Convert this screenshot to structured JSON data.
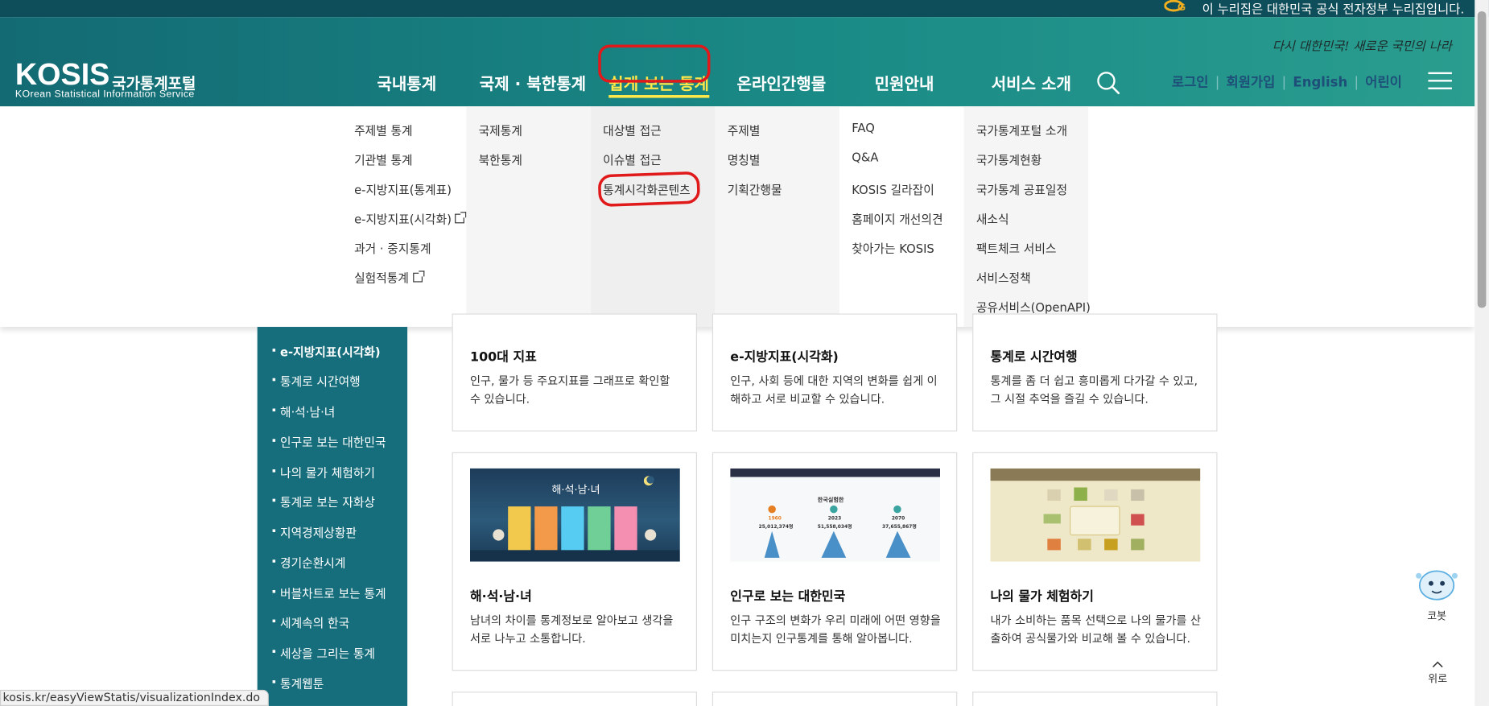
{
  "gov_banner": {
    "text": "이 누리집은 대한민국 공식 전자정부 누리집입니다."
  },
  "header": {
    "slogan": "다시 대한민국! 새로운 국민의 나라",
    "logo_main": "KOSIS",
    "logo_kor": "국가통계포털",
    "logo_sub": "KOrean Statistical Information Service"
  },
  "gnb": [
    {
      "label": "국내통계"
    },
    {
      "label": "국제 · 북한통계"
    },
    {
      "label": "쉽게 보는 통계"
    },
    {
      "label": "온라인간행물"
    },
    {
      "label": "민원안내"
    },
    {
      "label": "서비스 소개"
    }
  ],
  "util_links": [
    "로그인",
    "회원가입",
    "English",
    "어린이"
  ],
  "mega_menu": {
    "col1": [
      "주제별 통계",
      "기관별 통계",
      "e-지방지표(통계표)",
      "e-지방지표(시각화)",
      "과거 · 중지통계",
      "실험적통계"
    ],
    "col2": [
      "국제통계",
      "북한통계"
    ],
    "col3": [
      "대상별 접근",
      "이슈별 접근",
      "통계시각화콘텐츠"
    ],
    "col4": [
      "주제별",
      "명칭별",
      "기획간행물"
    ],
    "col5": [
      "FAQ",
      "Q&A",
      "KOSIS 길라잡이",
      "홈페이지 개선의견",
      "찾아가는 KOSIS"
    ],
    "col6": [
      "국가통계포털 소개",
      "국가통계현황",
      "국가통계 공표일정",
      "새소식",
      "팩트체크 서비스",
      "서비스정책",
      "공유서비스(OpenAPI)"
    ]
  },
  "sidebar": [
    "e-지방지표(시각화)",
    "통계로 시간여행",
    "해·석·남·녀",
    "인구로 보는 대한민국",
    "나의 물가 체험하기",
    "통계로 보는 자화상",
    "지역경제상황판",
    "경기순환시계",
    "버블차트로 보는 통계",
    "세계속의 한국",
    "세상을 그리는 통계",
    "통계웹툰"
  ],
  "cards_row1": [
    {
      "title": "100대 지표",
      "desc": "인구, 물가 등 주요지표를 그래프로 확인할 수 있습니다."
    },
    {
      "title": "e-지방지표(시각화)",
      "desc": "인구, 사회 등에 대한 지역의 변화를 쉽게 이해하고 서로 비교할 수 있습니다."
    },
    {
      "title": "통계로 시간여행",
      "desc": "통계를 좀 더 쉽고 흥미롭게 다가갈 수 있고, 그 시절 추억을 즐길 수 있습니다."
    }
  ],
  "cards_row2": [
    {
      "title": "해·석·남·녀",
      "desc": "남녀의 차이를 통계정보로 알아보고 생각을 서로 나누고 소통합니다.",
      "thumb_title": "해·석·남·녀"
    },
    {
      "title": "인구로 보는 대한민국",
      "desc": "인구 구조의 변화가 우리 미래에 어떤 영향을 미치는지 인구통계를 통해 알아봅니다.",
      "thumb_title": "한국실험한",
      "thumb_years": [
        "1960",
        "2023",
        "2070"
      ],
      "thumb_values": [
        "25,012,374명",
        "51,558,034명",
        "37,655,867명"
      ]
    },
    {
      "title": "나의 물가 체험하기",
      "desc": "내가 소비하는 품목 선택으로 나의 물가를 산출하여 공식물가와 비교해 볼 수 있습니다."
    }
  ],
  "floating": {
    "mascot_label": "코봇",
    "top_label": "위로"
  },
  "status_url": "kosis.kr/easyViewStatis/visualizationIndex.do",
  "colors": {
    "header_teal": "#136a73",
    "sidebar": "#166e7d",
    "active_gnb": "#ffe94a",
    "annotation": "#e0191b"
  }
}
